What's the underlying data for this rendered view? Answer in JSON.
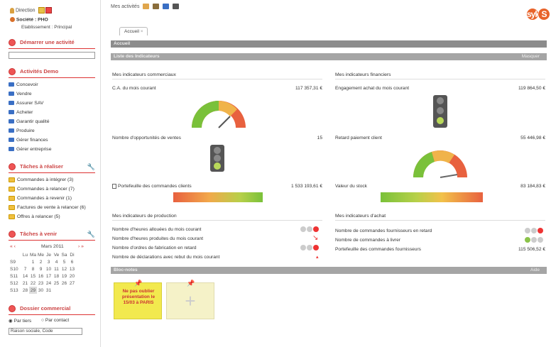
{
  "header": {
    "direction_label": "Direction",
    "societe_label": "Société : PHO",
    "etablissement_label": "Etablissement : Principal"
  },
  "sidebar": {
    "demarrer_title": "Démarrer une activité",
    "activites_title": "Activités Demo",
    "activites": [
      "Concevoir",
      "Vendre",
      "Assurer SAV",
      "Acheter",
      "Garantir qualité",
      "Produire",
      "Gérer finances",
      "Gérer entreprise"
    ],
    "taches_realiser_title": "Tâches à réaliser",
    "taches_realiser": [
      "Commandes à intégrer (3)",
      "Commandes à relancer (7)",
      "Commandes à revenir (1)",
      "Factures de vente à relancer (6)",
      "Offres à relancer (5)"
    ],
    "taches_venir_title": "Tâches à venir",
    "calendar": {
      "month": "Mars 2011",
      "nav_prev": "« ‹",
      "nav_next": "› »",
      "days": [
        "Lu",
        "Ma",
        "Me",
        "Je",
        "Ve",
        "Sa",
        "Di"
      ],
      "weeks": [
        {
          "wk": "S9",
          "days": [
            "",
            "1",
            "2",
            "3",
            "4",
            "5",
            "6"
          ]
        },
        {
          "wk": "S10",
          "days": [
            "7",
            "8",
            "9",
            "10",
            "11",
            "12",
            "13"
          ]
        },
        {
          "wk": "S11",
          "days": [
            "14",
            "15",
            "16",
            "17",
            "18",
            "19",
            "20"
          ]
        },
        {
          "wk": "S12",
          "days": [
            "21",
            "22",
            "23",
            "24",
            "25",
            "26",
            "27"
          ]
        },
        {
          "wk": "S13",
          "days": [
            "28",
            "29",
            "30",
            "31",
            "",
            "",
            ""
          ]
        }
      ]
    },
    "dossier_title": "Dossier commercial",
    "radio_tiers": "Par tiers",
    "radio_contact": "Par contact",
    "search_value": "Raison sociale, Code"
  },
  "topbar": {
    "label": "Mes activités"
  },
  "logo": {
    "text": "sylob",
    "mark": "S"
  },
  "tab": {
    "label": "Accueil"
  },
  "bars": {
    "accueil": "Accueil",
    "indicateurs": "Liste des Indicateurs",
    "indicateurs_right": "Masquer",
    "postits": "Bloc-notes",
    "postits_right": "Aide"
  },
  "commercial": {
    "title": "Mes indicateurs commerciaux",
    "ca_label": "C.A. du mois courant",
    "ca_value": "117 357,31 €",
    "opp_label": "Nombre d'opportunités de ventes",
    "opp_value": "15",
    "portefeuille_label": "Portefeuille des commandes clients",
    "portefeuille_value": "1 533 193,61 €"
  },
  "financier": {
    "title": "Mes indicateurs financiers",
    "engagement_label": "Engagement achat du mois courant",
    "engagement_value": "119 864,50 €",
    "retard_label": "Retard paiement client",
    "retard_value": "55 446,98 €",
    "stock_label": "Valeur du stock",
    "stock_value": "83 184,83 €"
  },
  "production": {
    "title": "Mes indicateurs de production",
    "rows": [
      "Nombre d'heures allouées du mois courant",
      "Nombre d'heures produites du mois courant",
      "Nombre d'ordres de fabrication en retard",
      "Nombre de déclarations avec rebut du mois courant"
    ]
  },
  "achat": {
    "title": "Mes indicateurs d'achat",
    "rows": [
      "Nombre de commandes fournisseurs en retard",
      "Nombre de commandes à livrer",
      "Portefeuille des commandes fournisseurs"
    ],
    "portefeuille_value": "115 506,52 €"
  },
  "postit": {
    "text": "Ne pas oublier présentation le 15/03 à PARIS",
    "add": "+"
  }
}
